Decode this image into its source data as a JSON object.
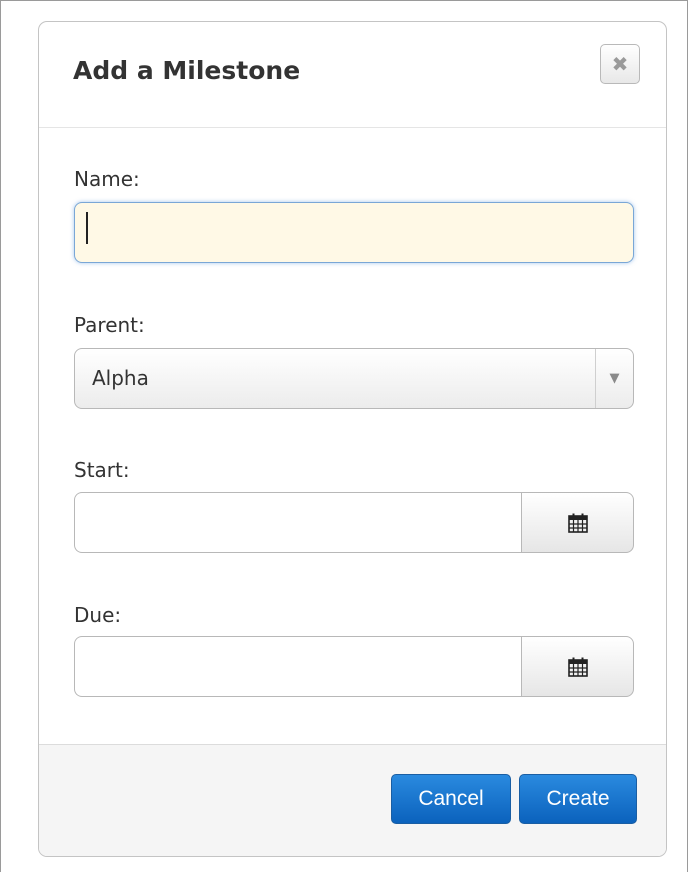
{
  "dialog": {
    "title": "Add a Milestone",
    "close_symbol": "✖"
  },
  "fields": {
    "name": {
      "label": "Name:",
      "value": ""
    },
    "parent": {
      "label": "Parent:",
      "selected": "Alpha"
    },
    "start": {
      "label": "Start:",
      "value": ""
    },
    "due": {
      "label": "Due:",
      "value": ""
    }
  },
  "icons": {
    "close": "close-icon",
    "dropdown": "caret-down-icon",
    "calendar": "calendar-icon"
  },
  "buttons": {
    "cancel": "Cancel",
    "create": "Create"
  },
  "colors": {
    "primary_button": "#1a73d0",
    "focused_input_bg": "#fff9e6",
    "footer_bg": "#f5f5f5"
  }
}
